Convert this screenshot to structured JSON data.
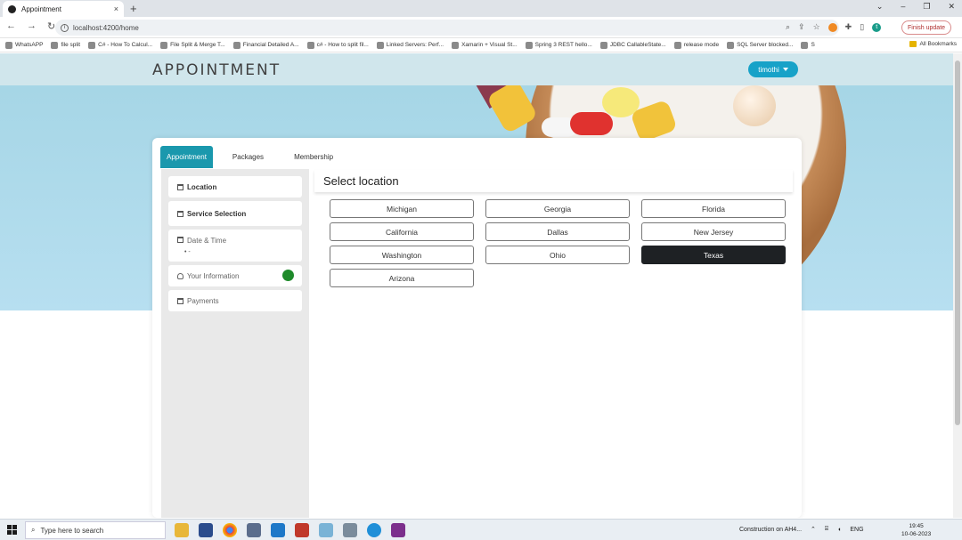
{
  "browser": {
    "tab_title": "Appointment",
    "tab_close": "×",
    "new_tab": "+",
    "url": "localhost:4200/home",
    "finish_update": "Finish update",
    "bookmarks": [
      "WhatsAPP",
      "file split",
      "C# - How To Calcul...",
      "File Split & Merge T...",
      "Financial Detailed A...",
      "c# - How to split fil...",
      "Linked Servers: Perf...",
      "Xamarin + Visual St...",
      "Spring 3 REST hello...",
      "JDBC CallableState...",
      "release mode",
      "SQL Server blocked...",
      "S"
    ],
    "all_bookmarks": "All Bookmarks",
    "profile_initial": "t"
  },
  "header": {
    "brand": "APPOINTMENT",
    "user": "timothi"
  },
  "tabs": [
    {
      "label": "Appointment",
      "active": true
    },
    {
      "label": "Packages",
      "active": false
    },
    {
      "label": "Membership",
      "active": false
    }
  ],
  "steps": [
    {
      "label": "Location"
    },
    {
      "label": "Service Selection"
    },
    {
      "label": "Date & Time",
      "sub": "• -"
    },
    {
      "label": "Your Information"
    },
    {
      "label": "Payments"
    }
  ],
  "content": {
    "title": "Select location",
    "locations": [
      "Michigan",
      "Georgia",
      "Florida",
      "California",
      "Dallas",
      "New Jersey",
      "Washington",
      "Ohio",
      "Texas",
      "Arizona"
    ],
    "selected": "Texas"
  },
  "taskbar": {
    "search_placeholder": "Type here to search",
    "notification": "Construction on AH4...",
    "lang": "ENG",
    "time": "19:45",
    "date": "10-06-2023"
  },
  "colors": {
    "accent": "#1a98ad",
    "user_button": "#17a2c8",
    "selected_location": "#1e2124",
    "status_complete": "#1e8a2a"
  }
}
